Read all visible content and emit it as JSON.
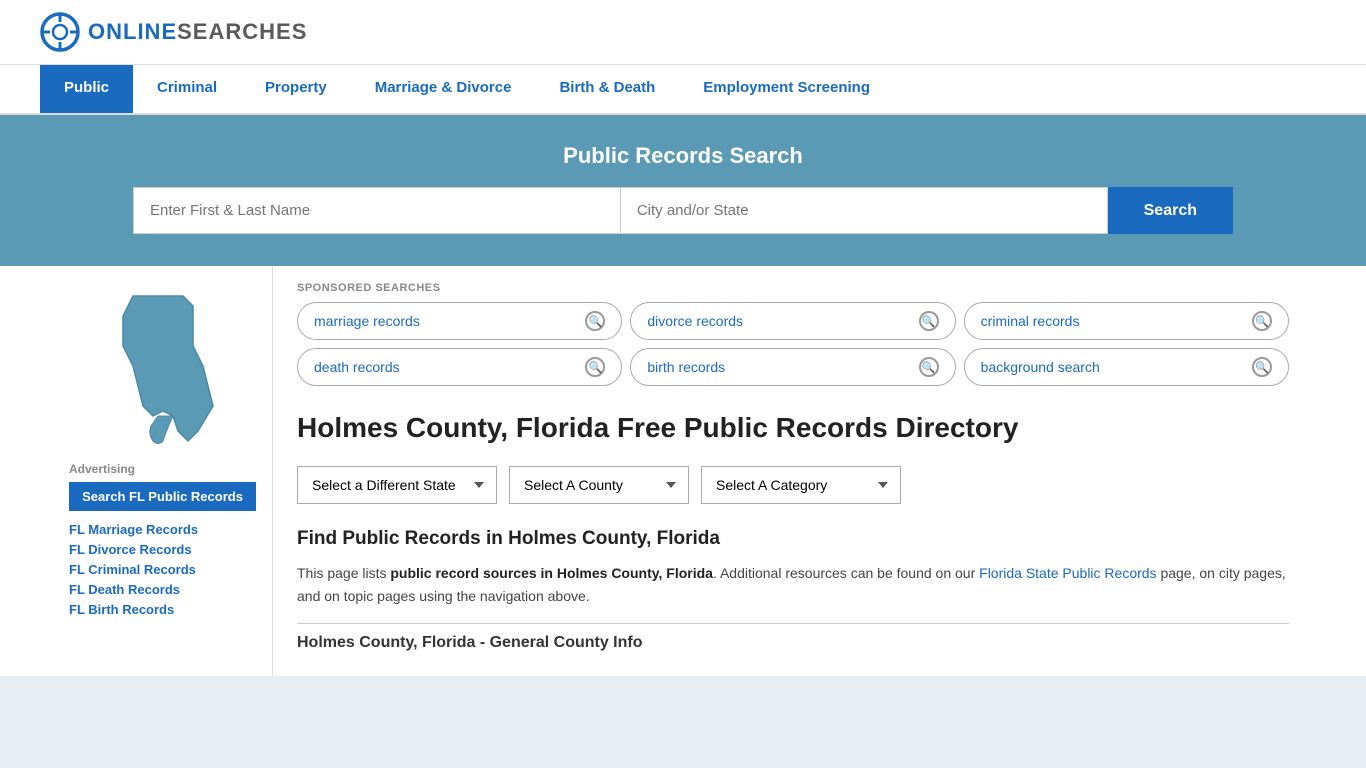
{
  "site": {
    "logo_text_bold": "ONLINE",
    "logo_text_light": "SEARCHES"
  },
  "nav": {
    "items": [
      {
        "label": "Public",
        "active": true
      },
      {
        "label": "Criminal",
        "active": false
      },
      {
        "label": "Property",
        "active": false
      },
      {
        "label": "Marriage & Divorce",
        "active": false
      },
      {
        "label": "Birth & Death",
        "active": false
      },
      {
        "label": "Employment Screening",
        "active": false
      }
    ]
  },
  "hero": {
    "title": "Public Records Search",
    "name_placeholder": "Enter First & Last Name",
    "location_placeholder": "City and/or State",
    "search_button": "Search"
  },
  "sponsored": {
    "label": "SPONSORED SEARCHES",
    "tags": [
      "marriage records",
      "divorce records",
      "criminal records",
      "death records",
      "birth records",
      "background search"
    ]
  },
  "page": {
    "title": "Holmes County, Florida Free Public Records Directory",
    "dropdowns": {
      "state": "Select a Different State",
      "county": "Select A County",
      "category": "Select A Category"
    },
    "find_title": "Find Public Records in Holmes County, Florida",
    "description_part1": "This page lists ",
    "description_bold1": "public record sources in Holmes County, Florida",
    "description_part2": ". Additional resources can be found on our ",
    "description_link": "Florida State Public Records",
    "description_part3": " page, on city pages, and on topic pages using the navigation above.",
    "county_info_label": "Holmes County, Florida - General County Info"
  },
  "sidebar": {
    "ad_label": "Advertising",
    "ad_button": "Search FL Public Records",
    "links": [
      {
        "label": "FL Marriage Records",
        "href": "#"
      },
      {
        "label": "FL Divorce Records",
        "href": "#"
      },
      {
        "label": "FL Criminal Records",
        "href": "#"
      },
      {
        "label": "FL Death Records",
        "href": "#"
      },
      {
        "label": "FL Birth Records",
        "href": "#"
      }
    ]
  },
  "colors": {
    "primary": "#1a6bbf",
    "hero_bg": "#5b9ab5",
    "nav_active_bg": "#1a6bbf"
  }
}
